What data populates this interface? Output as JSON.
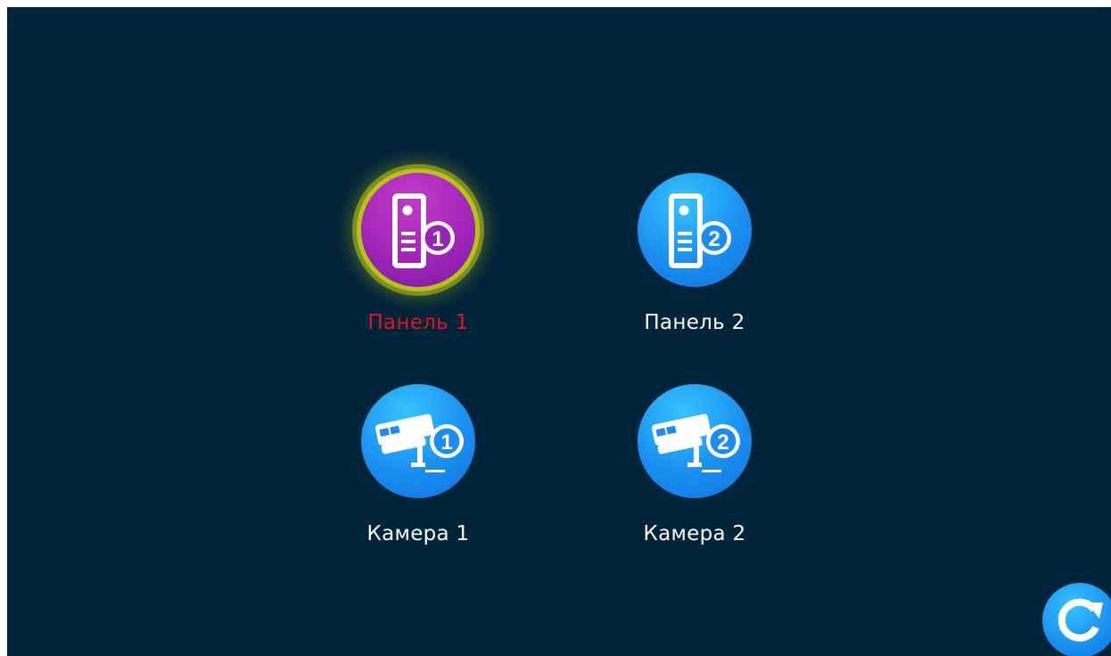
{
  "tiles": [
    {
      "label": "Панель 1",
      "icon": "door-panel-1-icon",
      "number": "1",
      "selected": true
    },
    {
      "label": "Панель 2",
      "icon": "door-panel-2-icon",
      "number": "2",
      "selected": false
    },
    {
      "label": "Камера 1",
      "icon": "camera-1-icon",
      "number": "1",
      "selected": false
    },
    {
      "label": "Камера 2",
      "icon": "camera-2-icon",
      "number": "2",
      "selected": false
    }
  ],
  "refresh": {
    "icon": "refresh-icon"
  },
  "colors": {
    "background": "#00243a",
    "icon_blue": "#1a8ff0",
    "selected_purple": "#a126b8",
    "selected_ring": "#b8c21a",
    "selected_label": "#e0141e",
    "label": "#ffffff"
  }
}
